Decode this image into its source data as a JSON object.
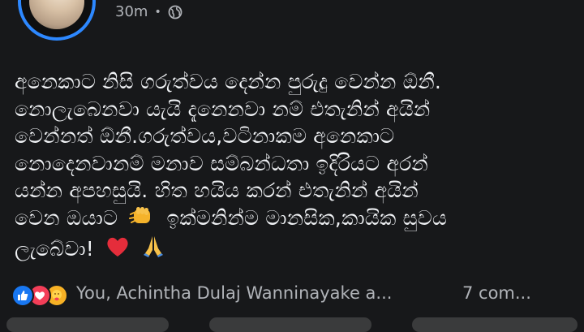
{
  "post": {
    "time": "30m",
    "separator": "•",
    "privacy_icon": "globe-icon",
    "lines": [
      "අනෙකාට නිසි ගරුත්වය දෙන්න පුරුදු වෙන්න ඕනී.",
      "නොලැබෙනවා යැයි දැනෙනවා නම් එතැනින් අයින්",
      "වෙන්නත් ඕනී.ගරුත්වය,වටිනාකම අනෙකාට",
      "නොදෙනවානම් මනාව සම්බන්ධතා ඉදිරියට අරන්",
      "යන්න අපහසුයි. හිත හයිය කරන් එතැනින් අයින්",
      "වෙන ඔයාට",
      "ඉක්මනින්ම මානසික,කායික සුවය",
      "ලැබේවා!"
    ],
    "emojis": [
      "fist-icon",
      "heart-icon",
      "pray-icon"
    ]
  },
  "footer": {
    "reaction_icons": [
      "like-icon",
      "love-icon",
      "care-icon"
    ],
    "reaction_summary": "You, Achintha Dulaj Wanninayake a...",
    "comments": "7 com..."
  },
  "colors": {
    "background": "#17181a",
    "text": "#f0f2f5",
    "muted": "#b0b3b8",
    "avatar_ring": "#2d88ff",
    "like": "#1877f2",
    "love": "#f33e58",
    "care": "#f7b125"
  }
}
